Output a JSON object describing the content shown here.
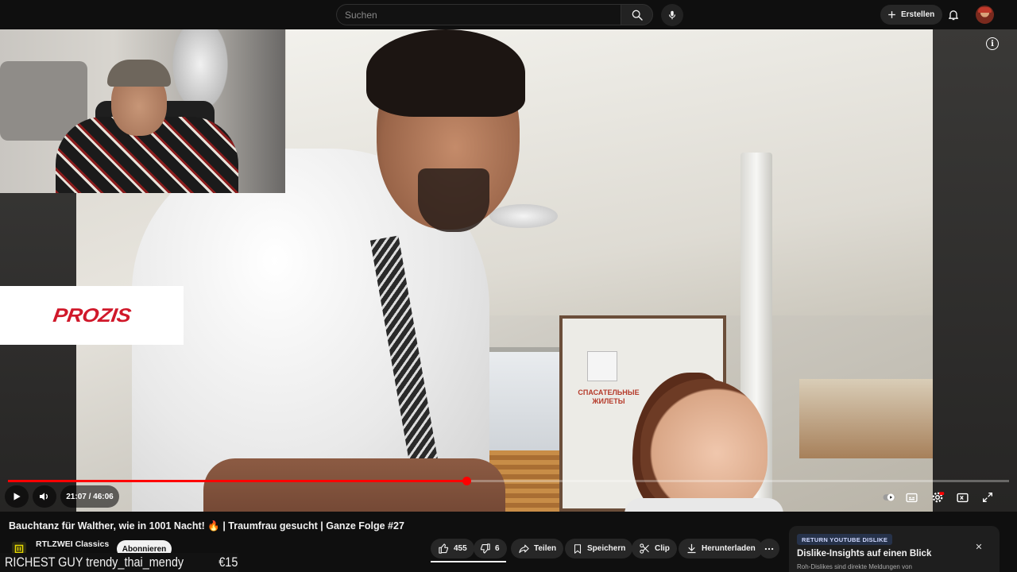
{
  "header": {
    "search_placeholder": "Suchen",
    "create_label": "Erstellen"
  },
  "player": {
    "current_time": "21:07",
    "duration": "46:06",
    "time_display": "21:07 / 46:06",
    "progress": 0.458,
    "sponsor_overlay": "PROZIS",
    "video_sign_text": "СПАСАТЕЛЬНЫЕ ЖИЛЕТЫ",
    "colors": {
      "progress": "#ff0000",
      "background": "#0f0f0f"
    }
  },
  "video": {
    "title": "Bauchtanz für Walther, wie in 1001 Nacht! 🔥 | Traumfrau gesucht | Ganze Folge #27",
    "channel_name": "RTLZWEI Classics",
    "subscribe_label": "Abonnieren"
  },
  "actions": {
    "like_count": "455",
    "dislike_count": "6",
    "share_label": "Teilen",
    "save_label": "Speichern",
    "clip_label": "Clip",
    "download_label": "Herunterladen"
  },
  "ryd": {
    "badge": "RETURN YOUTUBE DISLIKE",
    "title": "Dislike-Insights auf einen Blick",
    "subtitle": "Roh-Dislikes sind direkte Meldungen von"
  },
  "ticker": {
    "text": "RICHEST GUY trendy_thai_mendy",
    "amount": "€15"
  }
}
